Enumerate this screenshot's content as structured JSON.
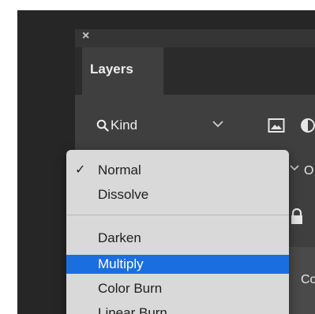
{
  "panel": {
    "close_glyph": "×",
    "tab_label": "Layers"
  },
  "filter": {
    "kind_label": "Kind",
    "icons": [
      "search-icon",
      "chevron-down-icon",
      "image-filter-icon",
      "adjustment-filter-icon"
    ]
  },
  "behind_menu": {
    "opacity_peek_text": "O",
    "layer_name_peek": "Co"
  },
  "blend_menu": {
    "checked_item": "Normal",
    "selected_item": "Multiply",
    "items": [
      "Normal",
      "Dissolve",
      "Darken",
      "Multiply",
      "Color Burn",
      "Linear Burn"
    ]
  },
  "colors": {
    "selection_highlight": "#1b6ee0",
    "menu_background": "#d9d9d9",
    "panel_background": "#3f3f3f",
    "app_background": "#262626"
  }
}
